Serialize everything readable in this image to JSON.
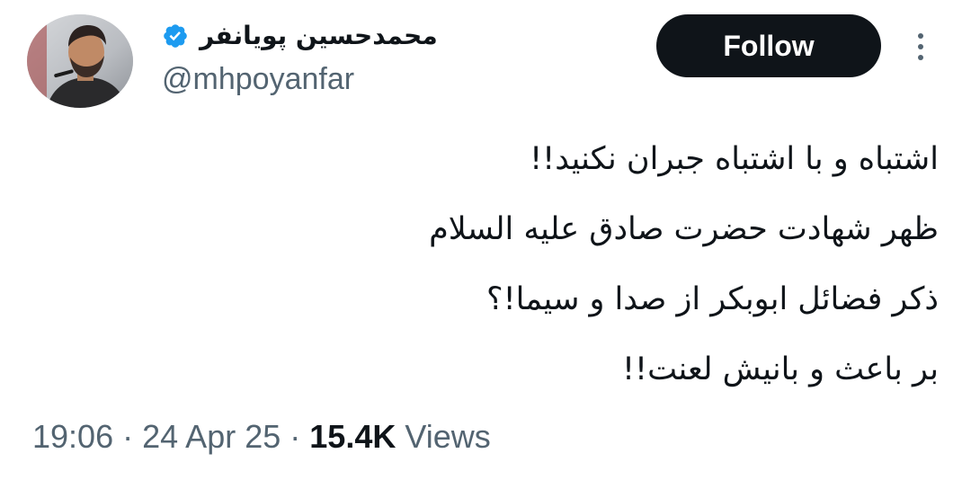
{
  "header": {
    "display_name": "محمدحسین پویانفر",
    "handle": "@mhpoyanfar",
    "follow_label": "Follow"
  },
  "tweet": {
    "lines": [
      "اشتباه و با اشتباه جبران نکنید!!",
      "ظهر شهادت حضرت صادق علیه السلام",
      "ذکر فضائل ابوبکر از صدا و سیما!؟",
      "بر باعث و بانیش لعنت!!"
    ]
  },
  "meta": {
    "time": "19:06",
    "separator": "·",
    "date": "24 Apr 25",
    "views_count": "15.4K",
    "views_label": "Views"
  },
  "colors": {
    "text": "#0f1419",
    "secondary": "#536471",
    "verified": "#1d9bf0",
    "follow_bg": "#0f1419"
  },
  "icons": {
    "verified": "verified-badge-icon",
    "more": "more-options-icon"
  }
}
